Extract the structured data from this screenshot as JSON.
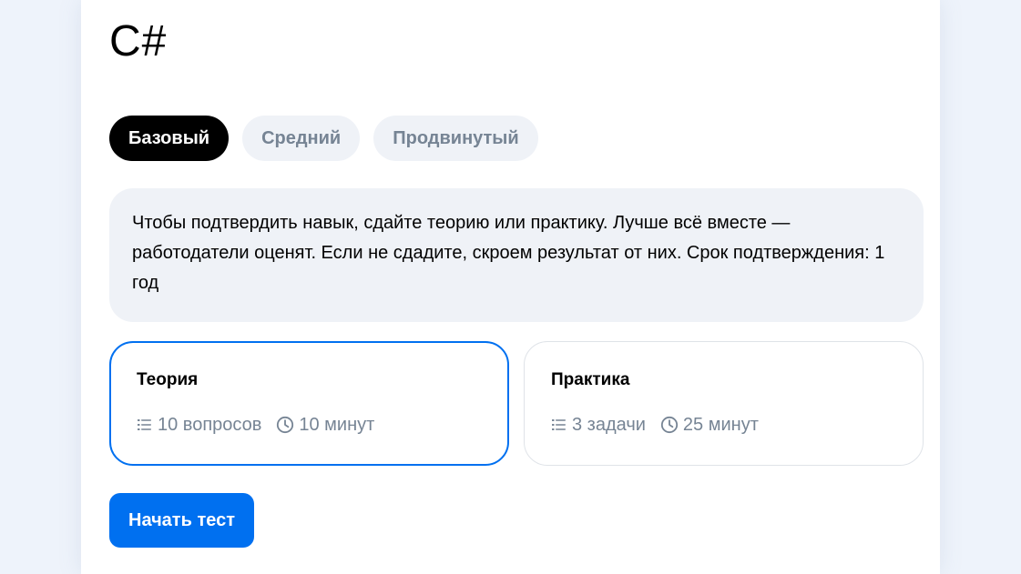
{
  "skill": {
    "title": "C#"
  },
  "levels": [
    {
      "label": "Базовый",
      "active": true
    },
    {
      "label": "Средний",
      "active": false
    },
    {
      "label": "Продвинутый",
      "active": false
    }
  ],
  "info": {
    "text": "Чтобы подтвердить навык, сдайте теорию или практику. Лучше всё вместе — работодатели оценят. Если не сдадите, скроем результат от них. Срок подтверждения: 1 год"
  },
  "options": [
    {
      "title": "Теория",
      "selected": true,
      "count_icon": "list-icon",
      "count": "10 вопросов",
      "time_icon": "clock-icon",
      "time": "10 минут"
    },
    {
      "title": "Практика",
      "selected": false,
      "count_icon": "list-icon",
      "count": "3 задачи",
      "time_icon": "clock-icon",
      "time": "25 минут"
    }
  ],
  "actions": {
    "start_label": "Начать тест"
  },
  "colors": {
    "accent": "#0070f0",
    "muted_text": "#768494",
    "panel_bg": "#eff2f7",
    "page_bg": "#eef3fb"
  }
}
